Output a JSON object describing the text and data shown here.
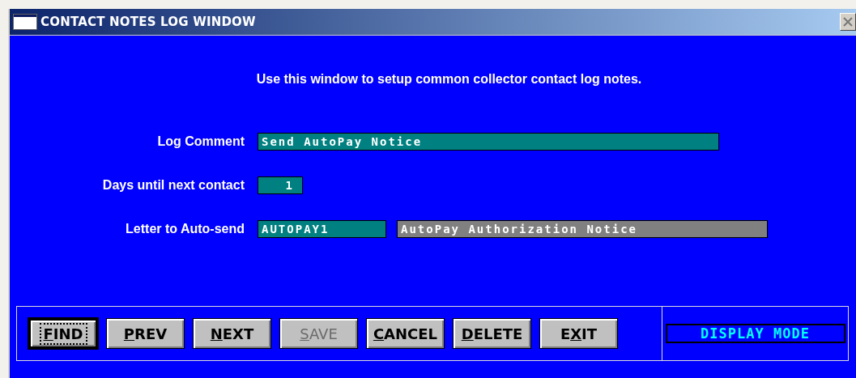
{
  "window": {
    "title": "CONTACT NOTES LOG WINDOW"
  },
  "instructions": "Use this window to setup common collector contact log notes.",
  "fields": [
    {
      "label": "Log Comment",
      "kind": "wide",
      "value": "Send AutoPay Notice"
    },
    {
      "label": "Days until next contact",
      "kind": "number",
      "value": "1"
    },
    {
      "label": "Letter to Auto-send",
      "kind": "lookup",
      "value": "AUTOPAY1",
      "description": "AutoPay Authorization Notice"
    }
  ],
  "buttons": [
    {
      "key": "F",
      "post": "IND",
      "disabled": false,
      "focused": true
    },
    {
      "key": "P",
      "post": "REV",
      "disabled": false,
      "focused": false
    },
    {
      "key": "N",
      "post": "EXT",
      "disabled": false,
      "focused": false
    },
    {
      "key": "S",
      "post": "AVE",
      "disabled": true,
      "focused": false
    },
    {
      "key": "C",
      "post": "ANCEL",
      "disabled": false,
      "focused": false
    },
    {
      "key": "D",
      "post": "ELETE",
      "disabled": false,
      "focused": false
    },
    {
      "pre": "E",
      "key": "X",
      "post": "IT",
      "disabled": false,
      "focused": false
    }
  ],
  "mode": "DISPLAY MODE"
}
